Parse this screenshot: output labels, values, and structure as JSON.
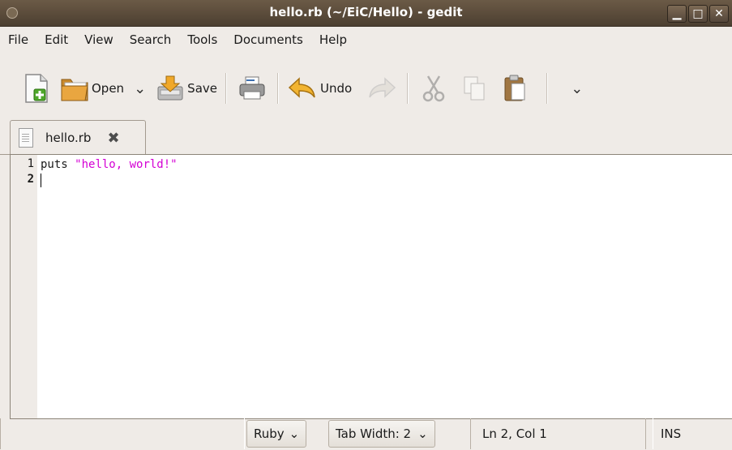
{
  "window": {
    "title": "hello.rb (~/EiC/Hello) - gedit",
    "buttons": {
      "minimize": "▁",
      "maximize": "□",
      "close": "✕"
    }
  },
  "menubar": {
    "items": [
      "File",
      "Edit",
      "View",
      "Search",
      "Tools",
      "Documents",
      "Help"
    ]
  },
  "toolbar": {
    "open_label": "Open",
    "save_label": "Save",
    "undo_label": "Undo",
    "chevron": "⌄",
    "overflow": "⌄"
  },
  "tabs": [
    {
      "label": "hello.rb",
      "close_icon": "✖"
    }
  ],
  "editor": {
    "line_numbers": [
      "1",
      "2"
    ],
    "line1_keyword": "puts",
    "line1_string": "\"hello, world!\""
  },
  "statusbar": {
    "language": "Ruby",
    "language_chevron": "⌄",
    "tab_width": "Tab Width:  2",
    "tab_chevron": "⌄",
    "position": "Ln 2, Col 1",
    "mode": "INS"
  },
  "colors": {
    "string": "#d400d4",
    "titlebar": "#5c4c3b"
  }
}
